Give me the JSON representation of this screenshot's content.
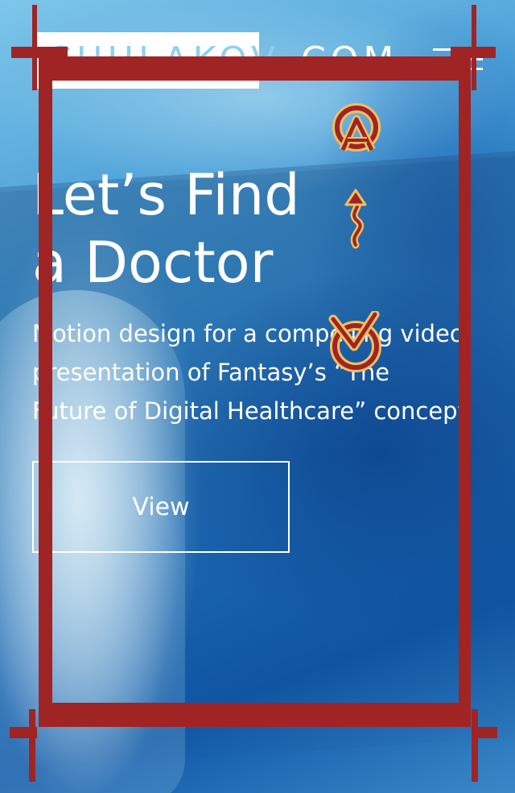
{
  "header": {
    "logo_main": "CHULAKOV",
    "logo_suffix": ".COM",
    "menu_icon": "hamburger-menu-icon"
  },
  "hero": {
    "title_line1": "Let’s Find",
    "title_line2": "a Doctor",
    "description": "Motion design for a compelling video presentation of Fantasy’s “The Future of Digital Healthcare” concept",
    "view_button_label": "View"
  },
  "overlay": {
    "frame_color": "#a02424",
    "emblem_fill": "#f0c060",
    "symbols": [
      "qa-circle-icon",
      "squiggle-arrow-icon",
      "check-circle-icon"
    ]
  }
}
